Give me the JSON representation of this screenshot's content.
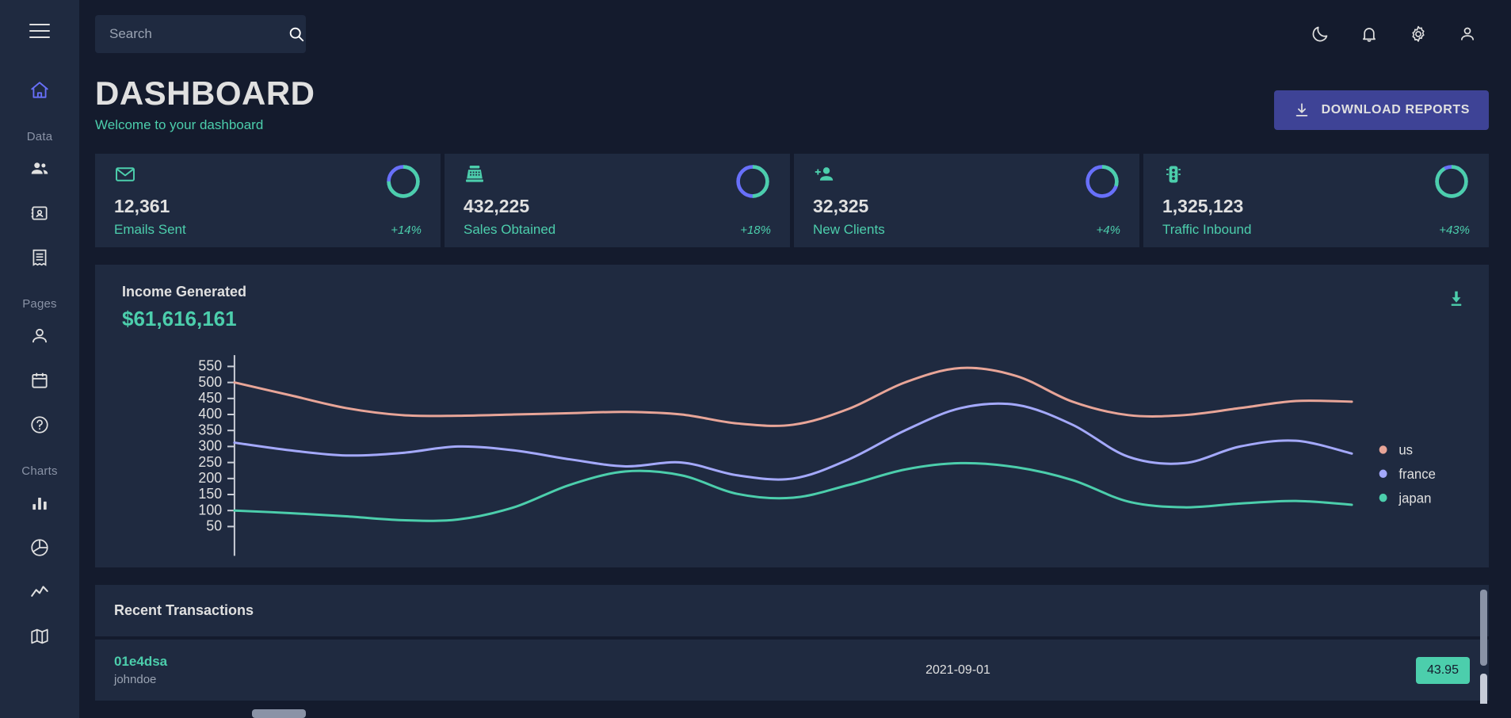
{
  "app": {
    "title": "DASHBOARD",
    "subtitle": "Welcome to your dashboard"
  },
  "search": {
    "placeholder": "Search",
    "value": ""
  },
  "topbar": {
    "icons": [
      {
        "name": "dark-mode-icon",
        "label": "Dark Mode"
      },
      {
        "name": "notifications-icon",
        "label": "Notifications"
      },
      {
        "name": "settings-icon",
        "label": "Settings"
      },
      {
        "name": "profile-icon",
        "label": "Profile"
      }
    ]
  },
  "download_button": {
    "label": "DOWNLOAD REPORTS",
    "icon": "download-icon",
    "color": "#3e4396"
  },
  "sidebar": {
    "menu_icon": "menu-burger-icon",
    "sections": [
      {
        "label": "",
        "items": [
          {
            "name": "home",
            "icon": "home-icon",
            "active": true
          }
        ]
      },
      {
        "label": "Data",
        "items": [
          {
            "name": "manage-team",
            "icon": "people-icon",
            "active": false
          },
          {
            "name": "contacts-information",
            "icon": "contacts-icon",
            "active": false
          },
          {
            "name": "invoices-balances",
            "icon": "receipt-icon",
            "active": false
          }
        ]
      },
      {
        "label": "Pages",
        "items": [
          {
            "name": "profile-form",
            "icon": "person-icon",
            "active": false
          },
          {
            "name": "calendar",
            "icon": "calendar-icon",
            "active": false
          },
          {
            "name": "faq-page",
            "icon": "help-icon",
            "active": false
          }
        ]
      },
      {
        "label": "Charts",
        "items": [
          {
            "name": "bar-chart",
            "icon": "bar-chart-icon",
            "active": false
          },
          {
            "name": "pie-chart",
            "icon": "pie-chart-icon",
            "active": false
          },
          {
            "name": "line-chart",
            "icon": "line-chart-icon",
            "active": false
          },
          {
            "name": "geography-chart",
            "icon": "map-icon",
            "active": false
          }
        ]
      }
    ]
  },
  "stats": [
    {
      "value": "12,361",
      "label": "Emails Sent",
      "delta": "+14%",
      "icon": "email-icon",
      "progress": 0.75,
      "progress_color": "#4cceac",
      "track_color": "#6870fa"
    },
    {
      "value": "432,225",
      "label": "Sales Obtained",
      "delta": "+18%",
      "icon": "point-of-sale-icon",
      "progress": 0.5,
      "progress_color": "#4cceac",
      "track_color": "#6870fa"
    },
    {
      "value": "32,325",
      "label": "New Clients",
      "delta": "+4%",
      "icon": "person-add-icon",
      "progress": 0.3,
      "progress_color": "#4cceac",
      "track_color": "#6870fa"
    },
    {
      "value": "1,325,123",
      "label": "Traffic Inbound",
      "delta": "+43%",
      "icon": "traffic-icon",
      "progress": 0.92,
      "progress_color": "#4cceac",
      "track_color": "#6870fa"
    }
  ],
  "revenue": {
    "title": "Income Generated",
    "amount": "$61,616,161",
    "download_icon": "download-icon"
  },
  "chart_data": {
    "type": "line",
    "title": "Income Generated",
    "xlabel": "",
    "ylabel": "",
    "ylim": [
      0,
      580
    ],
    "yticks": [
      50,
      100,
      150,
      200,
      250,
      300,
      350,
      400,
      450,
      500,
      550
    ],
    "grid": false,
    "legend_position": "right",
    "x": [
      0,
      1,
      2,
      3,
      4,
      5,
      6,
      7,
      8,
      9,
      10,
      11,
      12,
      13,
      14,
      15,
      16,
      17,
      18,
      19,
      20
    ],
    "series": [
      {
        "name": "us",
        "color": "#e8a598",
        "values": [
          500,
          460,
          420,
          398,
          396,
          400,
          404,
          408,
          400,
          372,
          368,
          418,
          500,
          545,
          520,
          440,
          398,
          398,
          420,
          442,
          440
        ]
      },
      {
        "name": "france",
        "color": "#a4a9fc",
        "values": [
          312,
          288,
          272,
          280,
          300,
          288,
          260,
          238,
          250,
          210,
          200,
          260,
          350,
          420,
          430,
          368,
          268,
          248,
          300,
          318,
          278
        ]
      },
      {
        "name": "japan",
        "color": "#4cceac",
        "values": [
          100,
          92,
          82,
          70,
          72,
          110,
          180,
          222,
          210,
          152,
          140,
          180,
          228,
          248,
          235,
          195,
          128,
          110,
          122,
          130,
          118
        ]
      }
    ]
  },
  "transactions": {
    "title": "Recent Transactions",
    "rows": [
      {
        "txId": "01e4dsa",
        "user": "johndoe",
        "date": "2021-09-01",
        "cost": "43.95"
      }
    ]
  }
}
